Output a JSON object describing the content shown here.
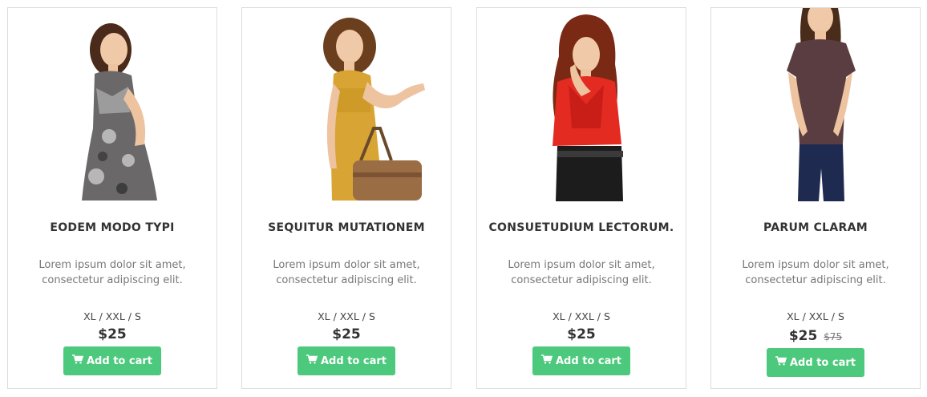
{
  "products": [
    {
      "name": "EODEM MODO TYPI",
      "description": "Lorem ipsum dolor sit amet, consectetur adipiscing elit.",
      "sizes": "XL / XXL / S",
      "price": "$25",
      "old_price": "",
      "button_label": "Add to cart",
      "image_icon": "woman-floral-dress-photo"
    },
    {
      "name": "SEQUITUR MUTATIONEM",
      "description": "Lorem ipsum dolor sit amet, consectetur adipiscing elit.",
      "sizes": "XL / XXL / S",
      "price": "$25",
      "old_price": "",
      "button_label": "Add to cart",
      "image_icon": "woman-yellow-dress-handbag-photo"
    },
    {
      "name": "CONSUETUDIUM LECTORUM.",
      "description": "Lorem ipsum dolor sit amet, consectetur adipiscing elit.",
      "sizes": "XL / XXL / S",
      "price": "$25",
      "old_price": "",
      "button_label": "Add to cart",
      "image_icon": "woman-red-jacket-photo"
    },
    {
      "name": "PARUM CLARAM",
      "description": "Lorem ipsum dolor sit amet, consectetur adipiscing elit.",
      "sizes": "XL / XXL / S",
      "price": "$25",
      "old_price": "$75",
      "button_label": "Add to cart",
      "image_icon": "woman-brown-tshirt-jeans-photo"
    }
  ],
  "colors": {
    "button": "#4cc97c",
    "border": "#dcdcdc"
  },
  "icons": {
    "cart": "shopping-cart-icon"
  }
}
